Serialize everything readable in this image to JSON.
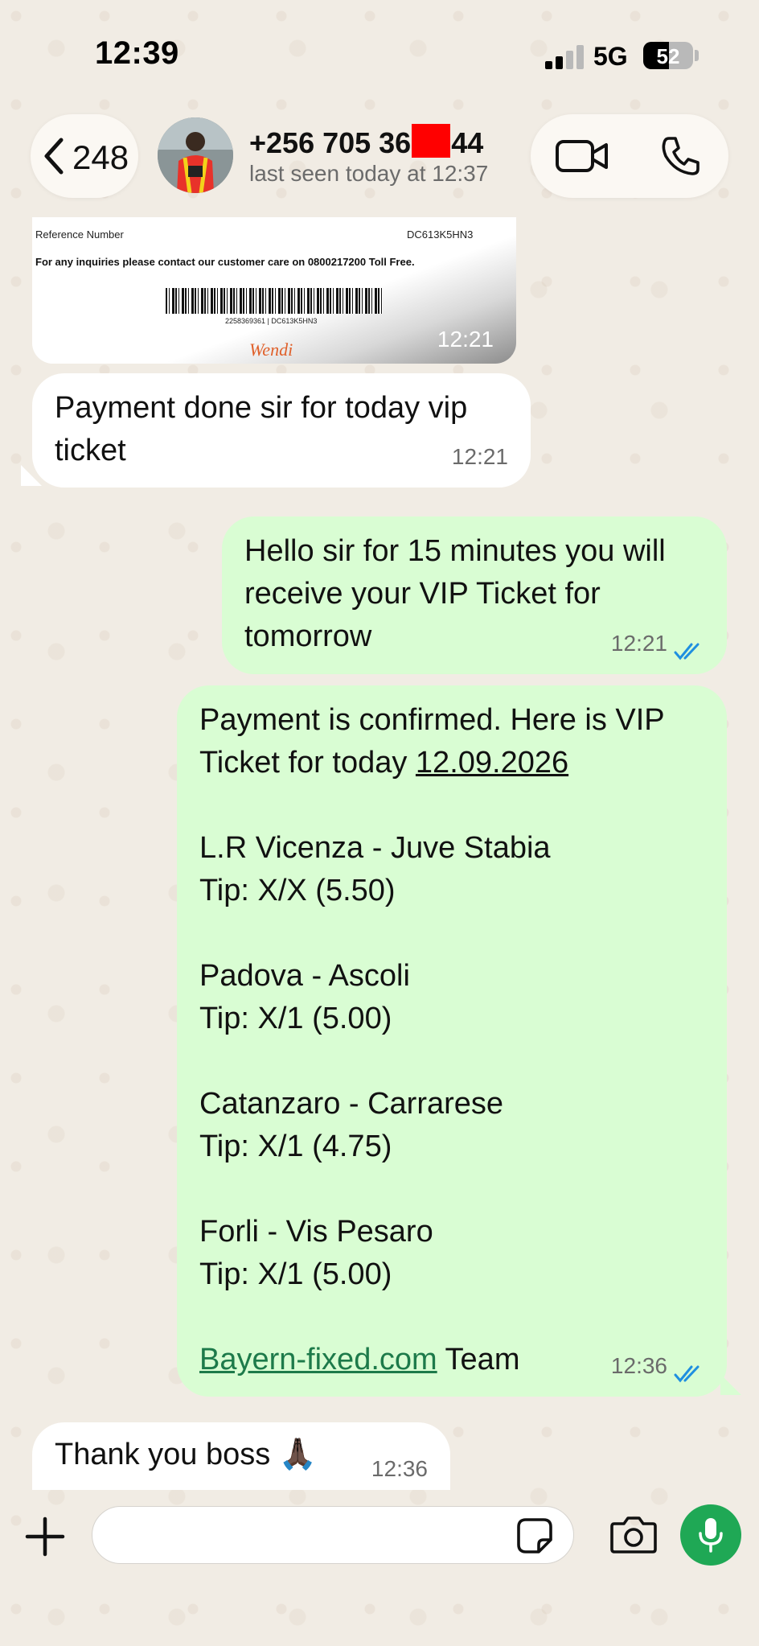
{
  "status_bar": {
    "time": "12:39",
    "network": "5G",
    "battery": "52",
    "battery_level_pct": 52
  },
  "header": {
    "back_count": "248",
    "contact_name_start": "+256 705 36",
    "contact_name_end": "44",
    "last_seen": "last seen today at 12:37",
    "video_call_icon": "video-camera-icon",
    "voice_call_icon": "phone-icon"
  },
  "messages": {
    "receipt_image": {
      "reference_label": "Reference Number",
      "reference_code": "DC613K5HN3",
      "inquiry_note": "For any inquiries please contact our customer care on 0800217200 Toll Free.",
      "barcode_number": "2258369361 | DC613K5HN3",
      "logo_text": "Wendi",
      "time": "12:21"
    },
    "m1": {
      "direction": "incoming",
      "line1": "Payment done sir for today vip",
      "line2": "ticket",
      "time": "12:21"
    },
    "m2": {
      "direction": "outgoing",
      "line1": "Hello sir for 15 minutes you will",
      "line2": "receive your VIP Ticket for",
      "line3": "tomorrow",
      "time": "12:21",
      "status": "read"
    },
    "m3": {
      "direction": "outgoing",
      "line1": "Payment is confirmed. Here is VIP",
      "line2_prefix": "Ticket for today",
      "line2_date": "12.09.2026",
      "match1": "L.R Vicenza - Juve Stabia",
      "tip1": "Tip: X/X (5.50)",
      "match2": "Padova - Ascoli",
      "tip2": "Tip: X/1 (5.00)",
      "match3": "Catanzaro - Carrarese",
      "tip3": "Tip: X/1 (4.75)",
      "match4": "Forli - Vis Pesaro",
      "tip4": "Tip: X/1 (5.00)",
      "link_text": "Bayern-fixed.com",
      "team_text": "Team",
      "time": "12:36",
      "status": "read"
    },
    "m4": {
      "direction": "incoming",
      "text": "Thank you boss",
      "emoji": "🙏🏿",
      "time": "12:36"
    }
  },
  "composer": {
    "placeholder": "",
    "attach_icon": "plus-icon",
    "sticker_icon": "sticker-icon",
    "camera_icon": "camera-icon",
    "mic_icon": "microphone-icon"
  },
  "colors": {
    "outgoing_bubble": "#d9fdd3",
    "incoming_bubble": "#ffffff",
    "read_ticks": "#1f8fe0",
    "mic_button": "#1fa855",
    "link": "#1d7a4a"
  }
}
